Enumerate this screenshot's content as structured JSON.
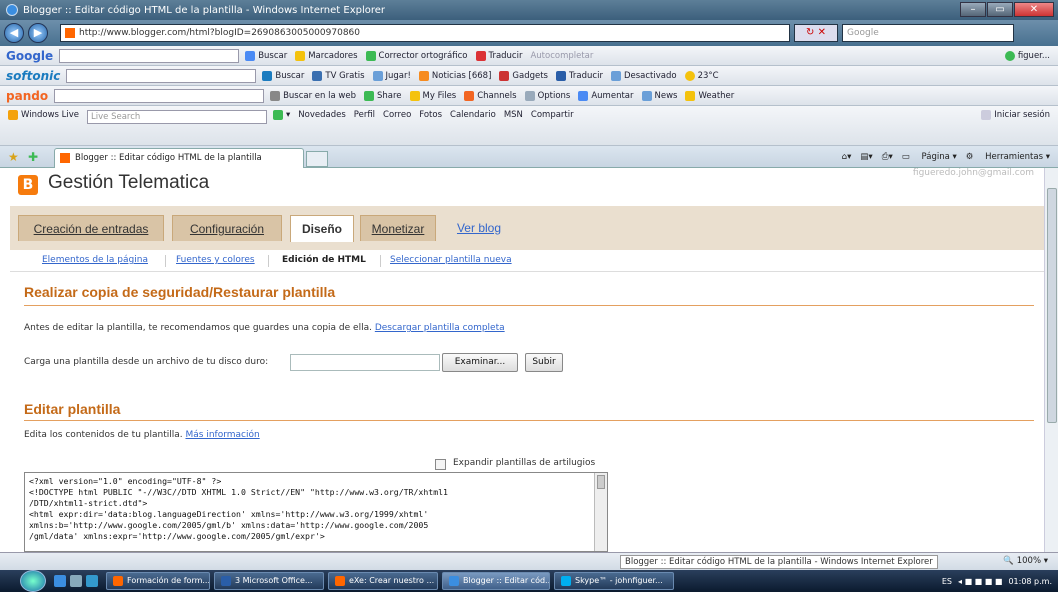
{
  "window": {
    "title": "Blogger :: Editar código HTML de la plantilla - Windows Internet Explorer",
    "url": "http://www.blogger.com/html?blogID=2690863005000970860",
    "search_placeholder": "Google"
  },
  "toolbars": {
    "google": {
      "brand": "Google",
      "items": [
        "Buscar",
        "Marcadores",
        "Corrector ortográfico",
        "Traducir",
        "Autocompletar"
      ],
      "user": "figuer..."
    },
    "softonic": {
      "brand": "softonic",
      "items": [
        "Buscar",
        "TV Gratis",
        "Jugar!",
        "Noticias [668]",
        "Gadgets",
        "Traducir",
        "Desactivado",
        "23°C"
      ]
    },
    "pando": {
      "brand": "pando",
      "items": [
        "Buscar en la web",
        "Share",
        "My Files",
        "Channels",
        "Options",
        "Aumentar",
        "News",
        "Weather"
      ]
    },
    "windowslive": {
      "brand": "Windows Live",
      "search_placeholder": "Live Search",
      "items": [
        "Novedades",
        "Perfil",
        "Correo",
        "Fotos",
        "Calendario",
        "MSN",
        "Compartir"
      ],
      "signin": "Iniciar sesión"
    }
  },
  "tabs": {
    "active_tab": "Blogger :: Editar código HTML de la plantilla",
    "commands": [
      "Página",
      "Herramientas"
    ]
  },
  "blog": {
    "icon": "B",
    "title": "Gestión Telematica",
    "email": "figueredo.john@gmail.com"
  },
  "main_tabs": [
    "Creación de entradas",
    "Configuración",
    "Diseño",
    "Monetizar",
    "Ver blog"
  ],
  "sub_tabs": [
    "Elementos de la página",
    "Fuentes y colores",
    "Edición de HTML",
    "Seleccionar plantilla nueva"
  ],
  "backup": {
    "title": "Realizar copia de seguridad/Restaurar plantilla",
    "text": "Antes de editar la plantilla, te recomendamos que guardes una copia de ella.",
    "download_link": "Descargar plantilla completa",
    "upload_label": "Carga una plantilla desde un archivo de tu disco duro:",
    "browse_button": "Examinar...",
    "upload_button": "Subir"
  },
  "edit": {
    "title": "Editar plantilla",
    "text": "Edita los contenidos de tu plantilla.",
    "more_link": "Más información",
    "expand_label": "Expandir plantillas de artilugios",
    "expand_checked": false,
    "code": "<?xml version=\"1.0\" encoding=\"UTF-8\" ?>\n<!DOCTYPE html PUBLIC \"-//W3C//DTD XHTML 1.0 Strict//EN\" \"http://www.w3.org/TR/xhtml1\n/DTD/xhtml1-strict.dtd\">\n<html expr:dir='data:blog.languageDirection' xmlns='http://www.w3.org/1999/xhtml'\nxmlns:b='http://www.google.com/2005/gml/b' xmlns:data='http://www.google.com/2005\n/gml/data' xmlns:expr='http://www.google.com/2005/gml/expr'>"
  },
  "status": {
    "tooltip": "Blogger :: Editar código HTML de la plantilla - Windows Internet Explorer",
    "zoom": "100%"
  },
  "taskbar": {
    "tasks": [
      "Formación de form...",
      "3 Microsoft Office...",
      "eXe: Crear nuestro ...",
      "Blogger :: Editar cód...",
      "Skype™ - johnfiguer..."
    ],
    "active_index": 3,
    "lang": "ES",
    "clock": "01:08 p.m."
  }
}
